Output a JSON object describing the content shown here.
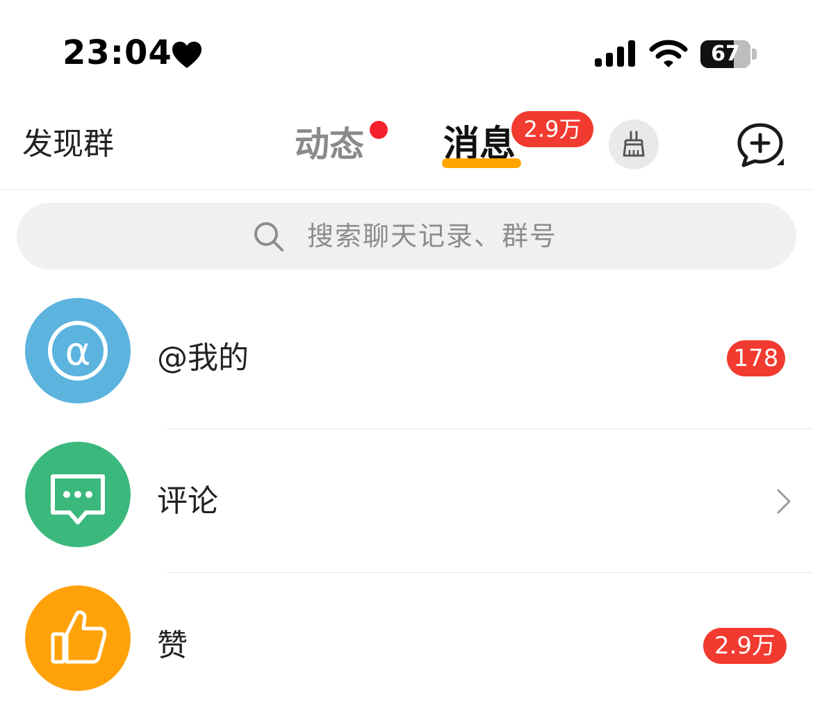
{
  "status_bar": {
    "time": "23:04",
    "battery": "67",
    "battery_level_percent": 67
  },
  "nav": {
    "discover_label": "发现群",
    "tabs": [
      {
        "label": "动态",
        "has_dot": true
      },
      {
        "label": "消息",
        "badge": "2.9万",
        "active": true
      }
    ]
  },
  "search": {
    "placeholder": "搜索聊天记录、群号"
  },
  "rows": [
    {
      "label": "@我的",
      "badge": "178",
      "icon": "at-icon",
      "color": "#5bb3de"
    },
    {
      "label": "评论",
      "icon": "comment-icon",
      "color": "#3bb97d",
      "trailing": "chevron-right-icon"
    },
    {
      "label": "赞",
      "badge": "2.9万",
      "icon": "thumbs-up-icon",
      "color": "#ffa20a"
    }
  ],
  "colors": {
    "accent": "#ffa500",
    "badge": "#f23b30"
  }
}
